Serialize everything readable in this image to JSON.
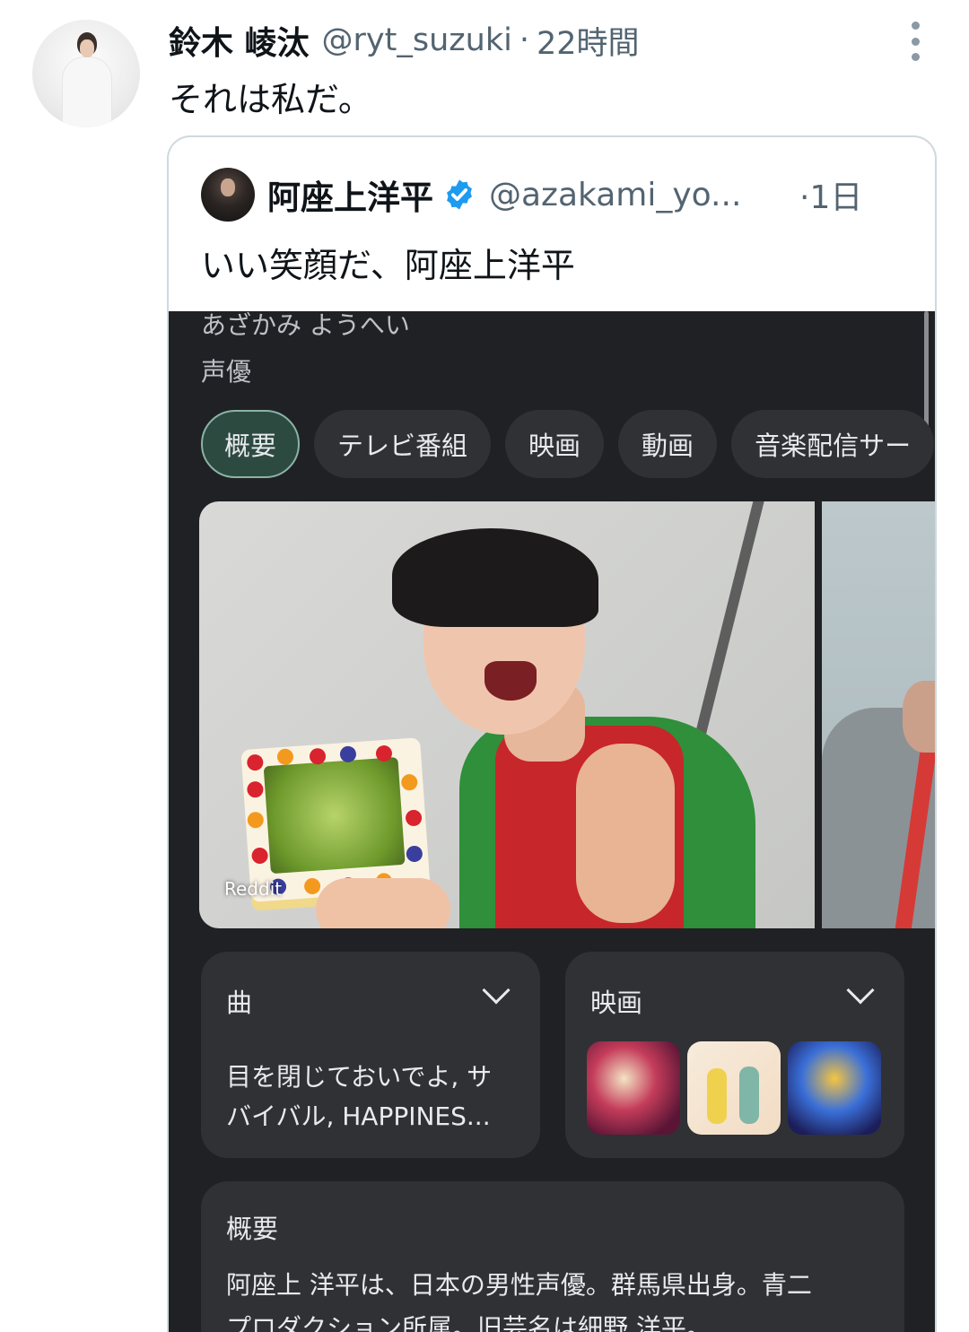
{
  "tweet": {
    "name": "鈴木 崚汰",
    "handle": "@ryt_suzuki",
    "separator": "·",
    "time": "22時間",
    "text": "それは私だ。"
  },
  "quoted": {
    "name": "阿座上洋平",
    "verified": true,
    "handle": "@azakami_yo...",
    "time": "·1日",
    "text": "いい笑顔だ、阿座上洋平"
  },
  "screenshot": {
    "kana": "あざかみ ようへい",
    "role": "声優",
    "chips": [
      "概要",
      "テレビ番組",
      "映画",
      "動画",
      "音楽配信サー"
    ],
    "image_source": "Reddit",
    "songs_card": {
      "title": "曲",
      "line1": "目を閉じておいでよ, サ",
      "line2": "バイバル, HAPPINES..."
    },
    "movies_card": {
      "title": "映画"
    },
    "overview": {
      "title": "概要",
      "line1": "阿座上 洋平は、日本の男性声優。群馬県出身。青二",
      "line2": "プロダクション所属。旧芸名は細野 洋平。"
    }
  },
  "colors": {
    "verified_badge": "#1d9bf0",
    "dark_bg": "#202124",
    "card_bg": "#303134",
    "active_chip": "#2d4a40"
  },
  "icons": [
    "more-icon",
    "verified-badge-icon",
    "chevron-down-icon"
  ]
}
